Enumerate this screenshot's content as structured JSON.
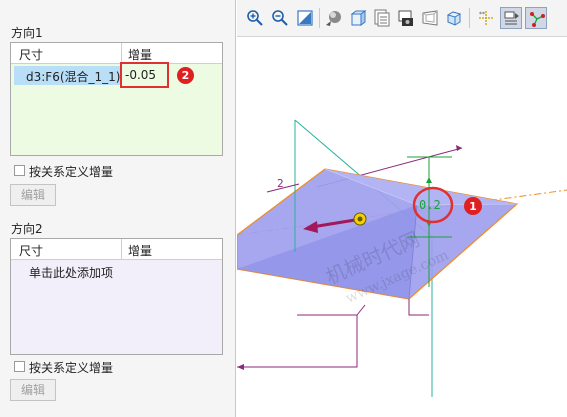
{
  "direction1": {
    "title": "方向1",
    "col_dimension": "尺寸",
    "col_increment": "增量",
    "row": {
      "dimension": "d3:F6(混合_1_1)",
      "increment": "-0.05"
    },
    "badge": "2"
  },
  "direction1_check": "按关系定义增量",
  "direction1_edit": "编辑",
  "direction2": {
    "title": "方向2",
    "col_dimension": "尺寸",
    "col_increment": "增量",
    "placeholder": "单击此处添加项"
  },
  "direction2_check": "按关系定义增量",
  "direction2_edit": "编辑",
  "viewport": {
    "dim_value": "0.2",
    "dim_label": "2",
    "badge": "1",
    "watermark": "机械时代网",
    "watermark_url": "www.jxage.com"
  },
  "colors": {
    "table1_bg": "#ecfbe2",
    "table2_bg": "#f2eefa",
    "selection": "#b9def7",
    "highlight": "#e03030",
    "part_fill": "#9ea0ee",
    "dim_green": "#1aa23a",
    "arrow": "#a2185a",
    "orange": "#f08c20"
  },
  "toolbar_icons": [
    "zoom-in-icon",
    "zoom-out-icon",
    "refit-icon",
    "shading-icon",
    "view-orientation-icon",
    "saved-views-icon",
    "display-style-icon",
    "perspective-icon",
    "spin-center-icon",
    "datum-display-icon",
    "annotation-display-icon",
    "pattern-display-icon"
  ]
}
